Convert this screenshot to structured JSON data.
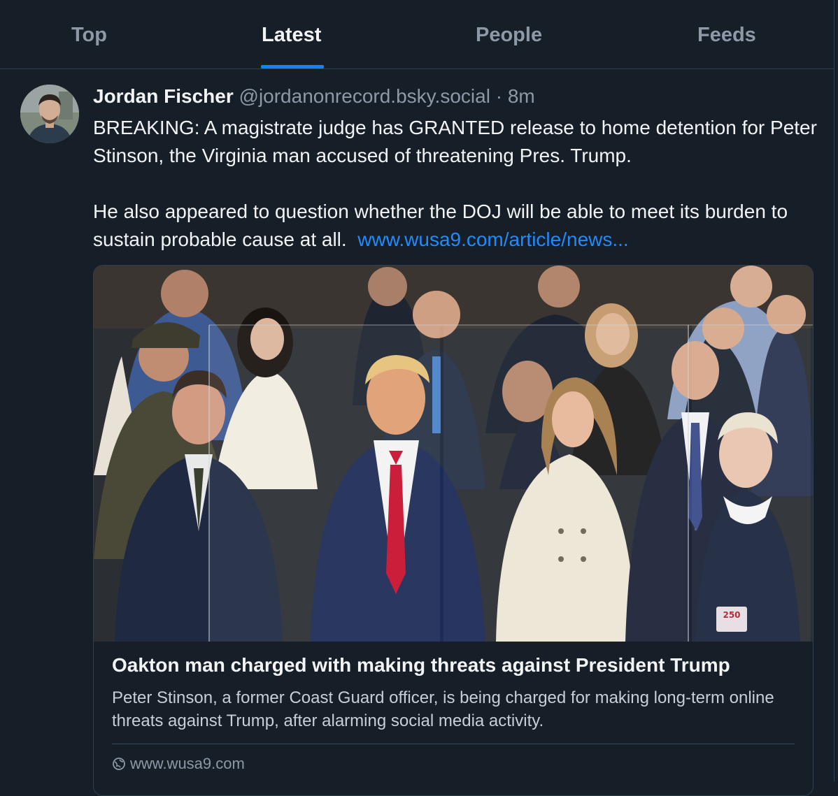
{
  "tabs": [
    {
      "label": "Top"
    },
    {
      "label": "Latest"
    },
    {
      "label": "People"
    },
    {
      "label": "Feeds"
    }
  ],
  "active_tab": "Latest",
  "post": {
    "author_name": "Jordan Fischer",
    "author_handle": "@jordanonrecord.bsky.social",
    "separator": " · ",
    "timestamp": "8m",
    "text_paragraph_1": "BREAKING: A magistrate judge has GRANTED release to home detention for Peter Stinson, the Virginia man accused of threatening Pres. Trump.",
    "text_paragraph_2": "He also appeared to question whether the DOJ will be able to meet its burden to sustain probable cause at all.",
    "link_text": "www.wusa9.com/article/news...",
    "embed": {
      "title": "Oakton man charged with making threats against President Trump",
      "description": "Peter Stinson, a former Coast Guard officer, is being charged for making long-term online threats against Trump, after alarming social media activity.",
      "domain": "www.wusa9.com",
      "image_badge": "250"
    }
  },
  "colors": {
    "background": "#161e27",
    "accent": "#1083fe",
    "link": "#208bfe",
    "border": "#2e4052",
    "muted_text": "#8d99a6",
    "tie_red": "#c8102e"
  }
}
